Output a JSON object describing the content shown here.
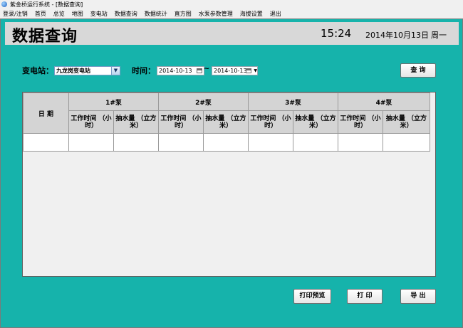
{
  "window": {
    "title": "紫金桥运行系统 - [数据查询]"
  },
  "menu": [
    "登录/注销",
    "首页",
    "总览",
    "地图",
    "变电站",
    "数据查询",
    "数据统计",
    "直方图",
    "水泵参数管理",
    "海拔设置",
    "退出"
  ],
  "header": {
    "title": "数据查询",
    "time": "15:24",
    "date": "2014年10月13日",
    "weekday": "周一"
  },
  "filters": {
    "station_label": "变电站：",
    "station_value": "九龙岗变电站",
    "time_label": "时间：",
    "start_date": "2014-10-13",
    "range_sep": "~",
    "end_date": "2014-10-13",
    "query_button": "查  询"
  },
  "table": {
    "date_header": "日  期",
    "pumps": [
      "1#泵",
      "2#泵",
      "3#泵",
      "4#泵"
    ],
    "sub_headers": {
      "work_time": "工作时间 （小时）",
      "water": "抽水量 （立方米）"
    }
  },
  "actions": {
    "print_preview": "打印预览",
    "print": "打  印",
    "export": "导  出"
  },
  "colors": {
    "background": "#16b3ab",
    "header_band": "#d8d8d8",
    "table_header": "#d4d4d4"
  }
}
